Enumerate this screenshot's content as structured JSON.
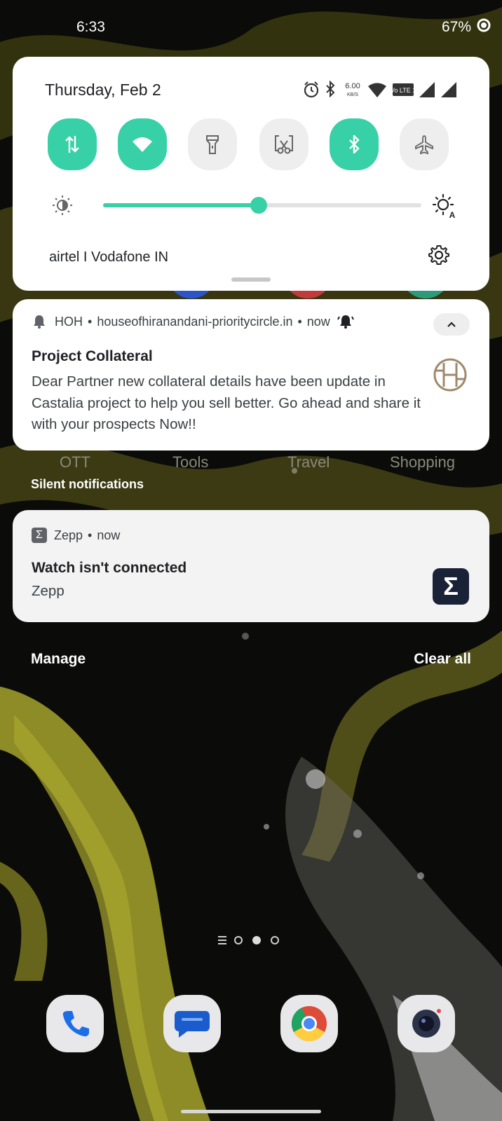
{
  "status_bar": {
    "time": "6:33",
    "battery": "67%"
  },
  "quick_settings": {
    "date": "Thursday, Feb 2",
    "net_speed_value": "6.00",
    "net_speed_unit": "KB/S",
    "volte_label": "Vo LTE 1",
    "toggles": [
      {
        "name": "mobile-data",
        "state": "on"
      },
      {
        "name": "wifi",
        "state": "on"
      },
      {
        "name": "flashlight",
        "state": "off"
      },
      {
        "name": "screenshot",
        "state": "off"
      },
      {
        "name": "bluetooth",
        "state": "on"
      },
      {
        "name": "airplane-mode",
        "state": "off"
      }
    ],
    "brightness_level": 0.49,
    "carrier": "airtel I Vodafone IN"
  },
  "notifications": [
    {
      "app": "HOH",
      "source": "houseofhiranandani-prioritycircle.in",
      "time": "now",
      "title": "Project Collateral",
      "body": "Dear Partner new collateral details have been update in Castalia project to help you sell better. Go ahead and share it with your prospects Now!!"
    }
  ],
  "home_folders": [
    "OTT",
    "Tools",
    "Travel",
    "Shopping"
  ],
  "silent_section": {
    "label": "Silent notifications",
    "notifications": [
      {
        "app": "Zepp",
        "time": "now",
        "title": "Watch isn't connected",
        "body": "Zepp",
        "icon_glyph": "Σ"
      }
    ]
  },
  "footer": {
    "manage": "Manage",
    "clear_all": "Clear all"
  },
  "pager": {
    "pages": 2,
    "active": 1
  },
  "dock": [
    "phone-icon",
    "messages-icon",
    "chrome-icon",
    "camera-icon"
  ],
  "colors": {
    "accent": "#38d0a7",
    "card": "#ffffff",
    "silent_card": "#f3f3f3",
    "wallpaper_paint": "#8e8c26"
  }
}
